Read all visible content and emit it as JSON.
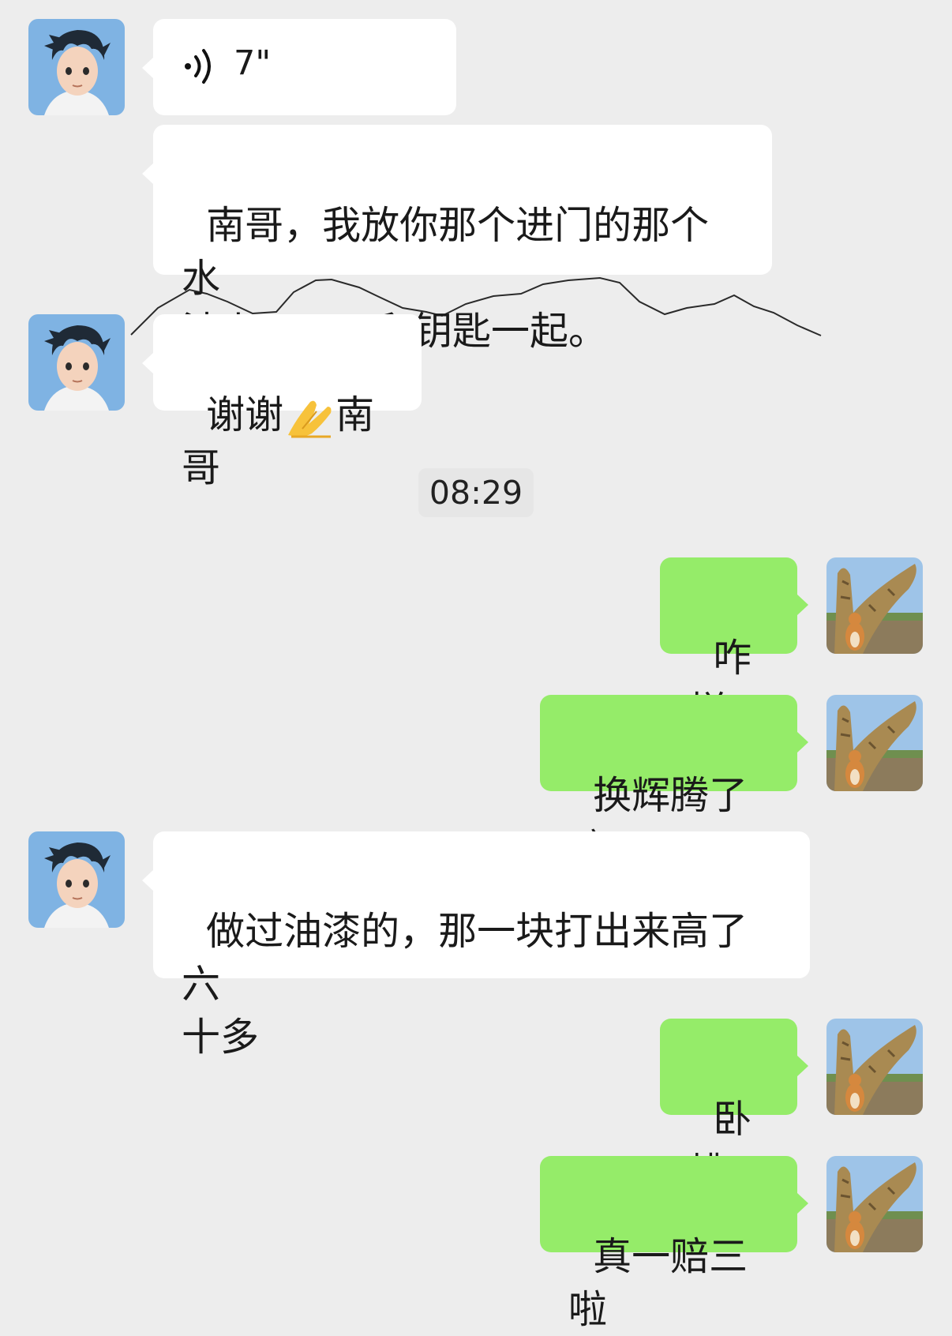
{
  "conversation": {
    "timestamp": "08:29",
    "messages": [
      {
        "sender": "contact",
        "type": "voice",
        "duration": "7\""
      },
      {
        "sender": "contact",
        "type": "text",
        "text": "南哥，我放你那个进门的那个水\n池上面了，和钥匙一起。"
      },
      {
        "sender": "contact",
        "type": "text",
        "text_before": "谢谢",
        "emoji": "folded-hands-emoji",
        "text_after": "南哥"
      },
      {
        "sender": "me",
        "type": "text",
        "text": "咋样"
      },
      {
        "sender": "me",
        "type": "text",
        "text": "换辉腾了嚒"
      },
      {
        "sender": "contact",
        "type": "text",
        "text": "做过油漆的，那一块打出来高了六\n十多"
      },
      {
        "sender": "me",
        "type": "text",
        "text": "卧槽"
      },
      {
        "sender": "me",
        "type": "text",
        "text": "真一赔三啦"
      }
    ]
  },
  "colors": {
    "background": "#ededed",
    "incoming_bubble": "#ffffff",
    "outgoing_bubble": "#95ec69",
    "timestamp_bg": "#e6e6e6"
  },
  "icons": {
    "contact_avatar": "anime-boy-avatar",
    "my_avatar": "dog-and-sculpture-avatar",
    "voice": "voice-wave-icon"
  }
}
